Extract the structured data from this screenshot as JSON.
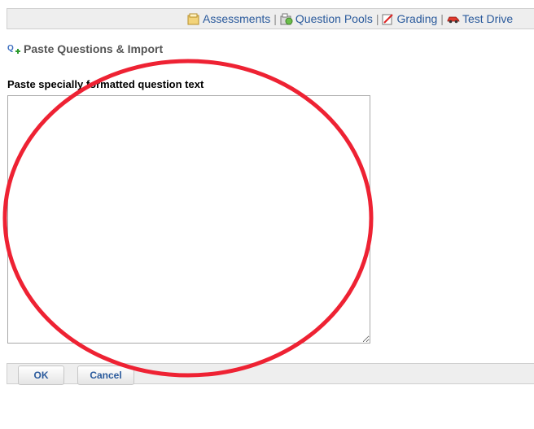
{
  "toolbar": {
    "links": [
      {
        "label": "Assessments",
        "icon": "assessments-icon"
      },
      {
        "label": "Question Pools",
        "icon": "question-pools-icon"
      },
      {
        "label": "Grading",
        "icon": "grading-icon"
      },
      {
        "label": "Test Drive",
        "icon": "test-drive-icon"
      }
    ],
    "separator": "|"
  },
  "page": {
    "title": "Paste Questions & Import",
    "title_icon": "import-questions-icon"
  },
  "form": {
    "paste_label": "Paste specially formatted question text",
    "paste_value": ""
  },
  "buttons": {
    "ok_label": "OK",
    "cancel_label": "Cancel"
  },
  "colors": {
    "link": "#2a5a9c",
    "annotation": "#ee2233",
    "bar_background": "#eeeeee"
  }
}
